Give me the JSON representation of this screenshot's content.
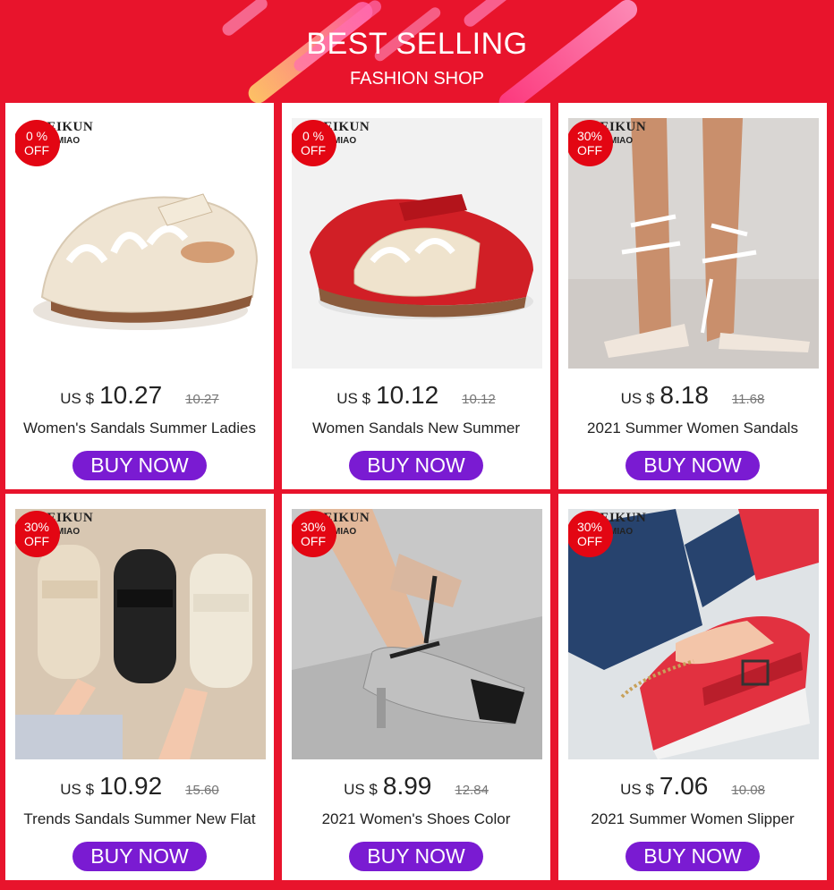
{
  "header": {
    "title": "BEST SELLING",
    "subtitle": "FASHION SHOP"
  },
  "colors": {
    "background": "#e8142c",
    "button": "#7a1bd2",
    "badge": "#e30613"
  },
  "products": [
    {
      "badge_pct": "0 %",
      "badge_off": "OFF",
      "brand": "WEIKUN",
      "brand_sub": "MIAO",
      "currency": "US $",
      "price": "10.27",
      "old_price": "10.27",
      "name": "Women's Sandals Summer Ladies",
      "button": "BUY NOW",
      "image": "beige-cutout-sandal"
    },
    {
      "badge_pct": "0 %",
      "badge_off": "OFF",
      "brand": "WEIKUN",
      "brand_sub": "MIAO",
      "currency": "US $",
      "price": "10.12",
      "old_price": "10.12",
      "name": "Women Sandals New Summer",
      "button": "BUY NOW",
      "image": "red-beige-sandal"
    },
    {
      "badge_pct": "30%",
      "badge_off": "OFF",
      "brand": "WEIKUN",
      "brand_sub": "MIAO",
      "currency": "US $",
      "price": "8.18",
      "old_price": "11.68",
      "name": "2021 Summer Women Sandals",
      "button": "BUY NOW",
      "image": "lace-up-heel"
    },
    {
      "badge_pct": "30%",
      "badge_off": "OFF",
      "brand": "WEIKUN",
      "brand_sub": "MIAO",
      "currency": "US $",
      "price": "10.92",
      "old_price": "15.60",
      "name": "Trends Sandals Summer New Flat",
      "button": "BUY NOW",
      "image": "quilted-flat-sandals"
    },
    {
      "badge_pct": "30%",
      "badge_off": "OFF",
      "brand": "WEIKUN",
      "brand_sub": "MIAO",
      "currency": "US $",
      "price": "8.99",
      "old_price": "12.84",
      "name": "2021 Women's Shoes Color",
      "button": "BUY NOW",
      "image": "silver-pointed-heel"
    },
    {
      "badge_pct": "30%",
      "badge_off": "OFF",
      "brand": "WEIKUN",
      "brand_sub": "MIAO",
      "currency": "US $",
      "price": "7.06",
      "old_price": "10.08",
      "name": "2021 Summer Women Slipper",
      "button": "BUY NOW",
      "image": "red-wedge-slipper"
    }
  ]
}
